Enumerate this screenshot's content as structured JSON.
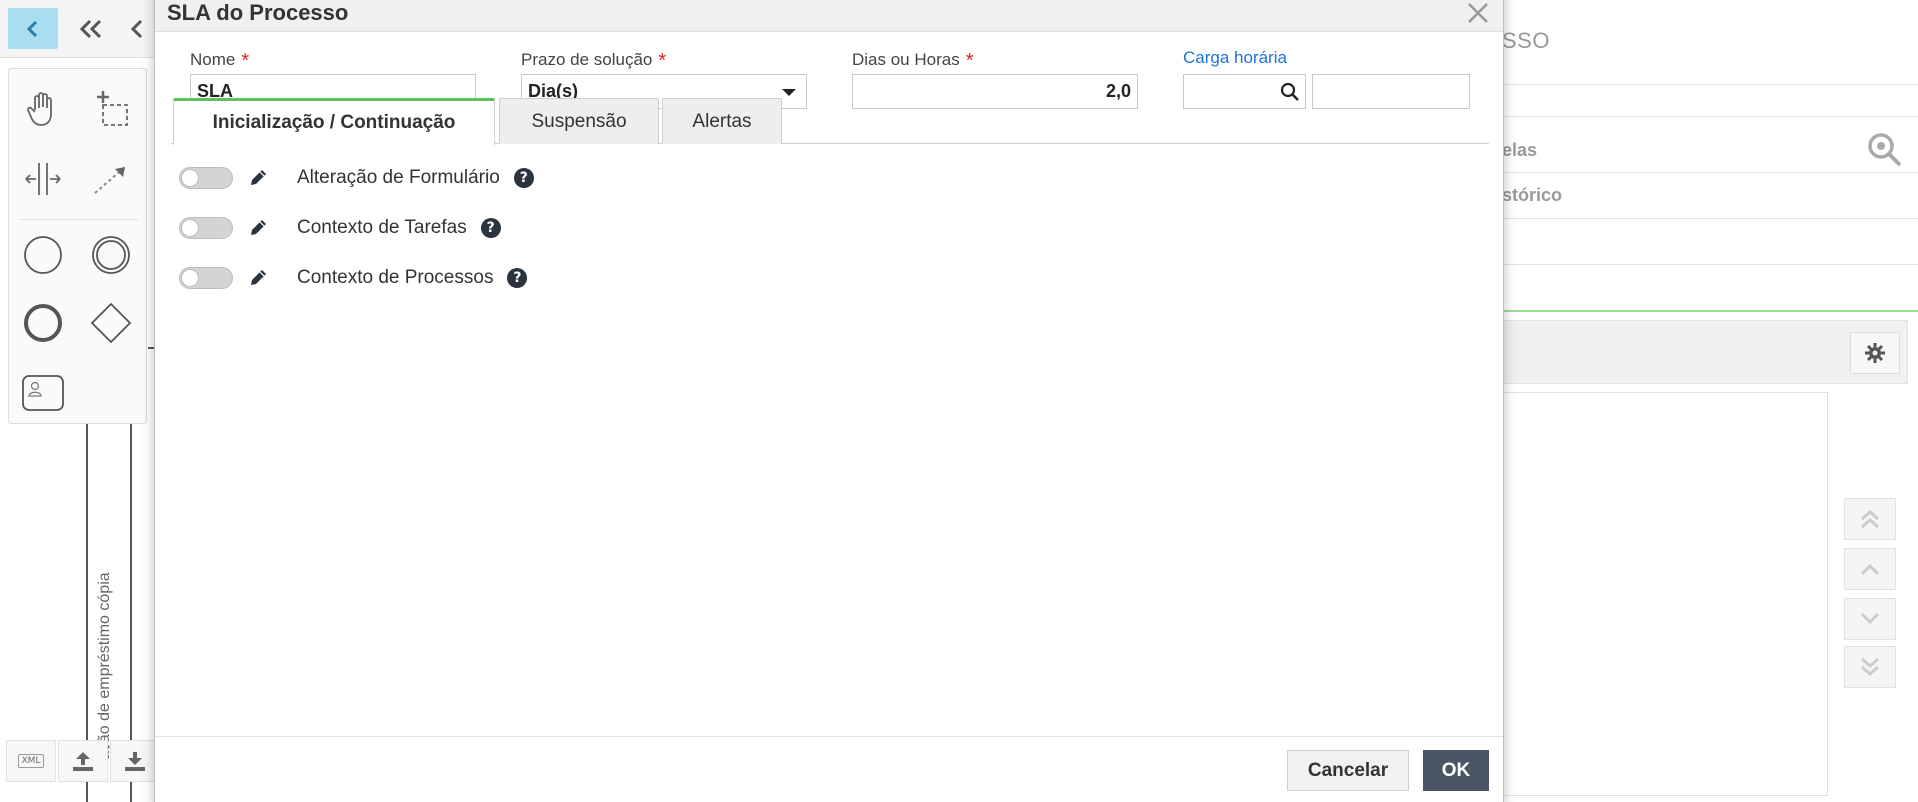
{
  "background": {
    "pool_label": "ação de empréstimo cópia",
    "right_panel": {
      "header": "SSO",
      "items": [
        "elas",
        "stórico"
      ]
    },
    "bottom_tools": [
      "xml-export",
      "upload",
      "download"
    ],
    "xml_label": "XML"
  },
  "modal": {
    "title": "SLA do Processo",
    "fields": {
      "nome": {
        "label": "Nome",
        "value": "SLA",
        "required": true
      },
      "prazo": {
        "label": "Prazo de solução",
        "value": "Dia(s)",
        "required": true
      },
      "dias_horas": {
        "label": "Dias ou Horas",
        "value": "2,0",
        "required": true
      },
      "carga": {
        "label": "Carga horária",
        "value": "",
        "extra_value": ""
      }
    },
    "required_mark": "*",
    "tabs": [
      {
        "label": "Inicialização / Continuação",
        "active": true
      },
      {
        "label": "Suspensão",
        "active": false
      },
      {
        "label": "Alertas",
        "active": false
      }
    ],
    "options": [
      {
        "label": "Alteração de Formulário",
        "enabled": false
      },
      {
        "label": "Contexto de Tarefas",
        "enabled": false
      },
      {
        "label": "Contexto de Processos",
        "enabled": false
      }
    ],
    "help_glyph": "?",
    "buttons": {
      "cancel": "Cancelar",
      "ok": "OK"
    }
  },
  "colors": {
    "accent_green": "#5cc35b",
    "link_blue": "#1d73d8",
    "primary_button": "#4a5566",
    "required_red": "#d22222",
    "active_nav": "#a9ddf0"
  }
}
